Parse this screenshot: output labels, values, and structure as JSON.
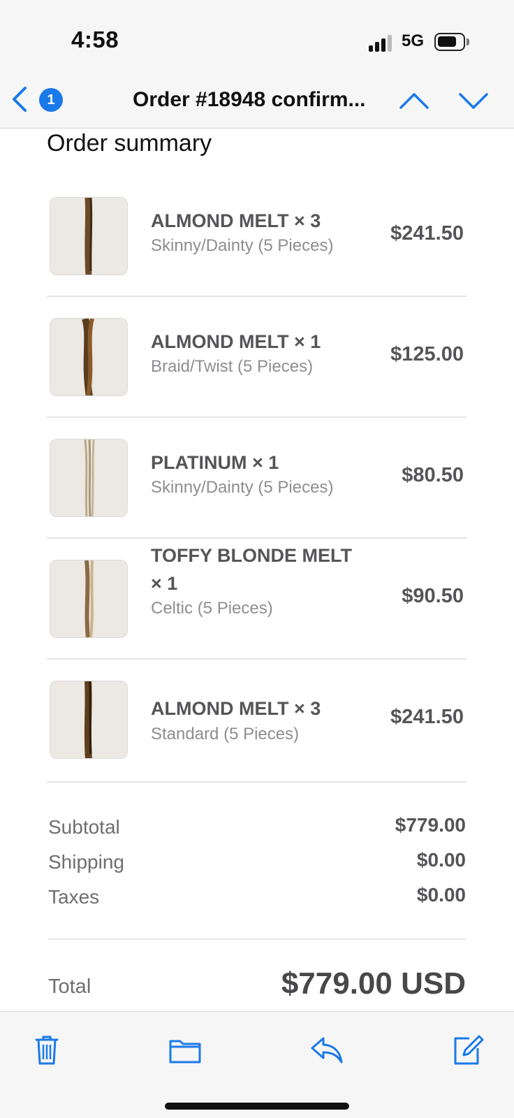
{
  "status_bar": {
    "time": "4:58",
    "network": "5G"
  },
  "nav": {
    "badge_count": "1",
    "title": "Order #18948 confirm..."
  },
  "section_title": "Order summary",
  "items": [
    {
      "name": "ALMOND MELT × 3",
      "variant": "Skinny/Dainty (5 Pieces)",
      "price": "$241.50",
      "thumb_color": "#6b4a26"
    },
    {
      "name": "ALMOND MELT × 1",
      "variant": "Braid/Twist (5 Pieces)",
      "price": "$125.00",
      "thumb_color": "#5a3c1e"
    },
    {
      "name": "PLATINUM × 1",
      "variant": "Skinny/Dainty (5 Pieces)",
      "price": "$80.50",
      "thumb_color": "#b9aa8a"
    },
    {
      "name": "TOFFY BLONDE MELT × 1",
      "variant": "Celtic (5 Pieces)",
      "price": "$90.50",
      "thumb_color": "#8a6a45"
    },
    {
      "name": "ALMOND MELT × 3",
      "variant": "Standard (5 Pieces)",
      "price": "$241.50",
      "thumb_color": "#5e3e1c"
    }
  ],
  "summary": {
    "subtotal_label": "Subtotal",
    "subtotal_value": "$779.00",
    "shipping_label": "Shipping",
    "shipping_value": "$0.00",
    "taxes_label": "Taxes",
    "taxes_value": "$0.00",
    "total_label": "Total",
    "total_value": "$779.00 USD"
  },
  "toolbar": {
    "icons": [
      "trash-icon",
      "folder-icon",
      "reply-icon",
      "compose-icon"
    ]
  },
  "colors": {
    "accent": "#1a7ae8",
    "text_secondary": "#8e8e92",
    "bar_bg": "#f6f6f7"
  }
}
